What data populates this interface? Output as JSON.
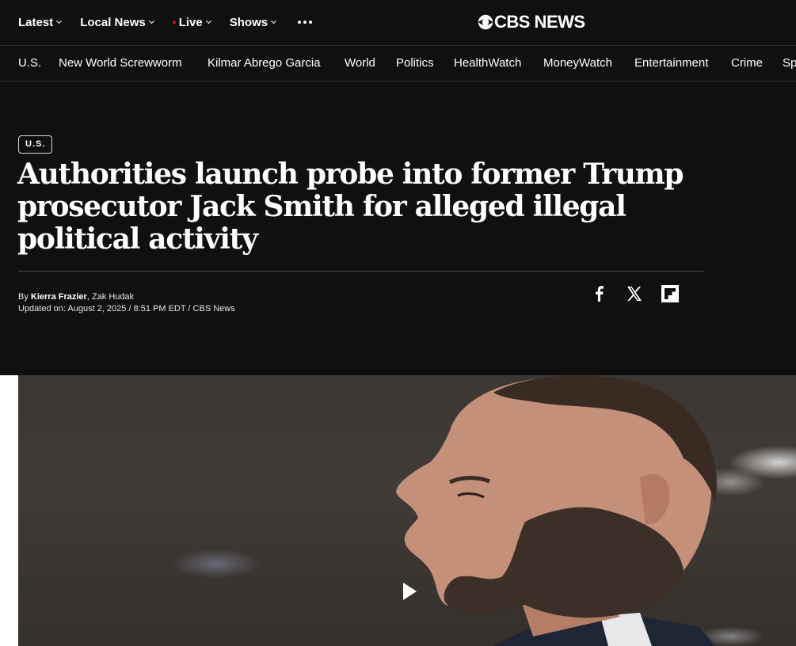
{
  "top_nav": {
    "items": [
      {
        "label": "Latest",
        "has_dropdown": true
      },
      {
        "label": "Local News",
        "has_dropdown": true
      },
      {
        "label": "Live",
        "has_dropdown": true,
        "live_indicator": true
      },
      {
        "label": "Shows",
        "has_dropdown": true
      }
    ],
    "more_icon": "more-horizontal-icon"
  },
  "logo": {
    "text": "CBS NEWS",
    "icon": "cbs-eye-icon"
  },
  "section_nav": {
    "items": [
      "U.S.",
      "New World Screwworm",
      "Kilmar Abrego Garcia",
      "World",
      "Politics",
      "HealthWatch",
      "MoneyWatch",
      "Entertainment",
      "Crime",
      "Sp"
    ]
  },
  "article": {
    "category": "U.S.",
    "headline": "Authorities launch probe into former Trump prosecutor Jack Smith for alleged illegal political activity",
    "byline_prefix": "By",
    "author_1": "Kierra Frazier",
    "author_sep": ",",
    "author_2": "Zak Hudak",
    "updated": "Updated on: August 2, 2025 / 8:51 PM EDT / CBS News"
  },
  "share": [
    {
      "name": "facebook-icon"
    },
    {
      "name": "x-icon"
    },
    {
      "name": "flipboard-icon"
    }
  ],
  "colors": {
    "background": "#101010",
    "text": "#ffffff",
    "live_dot": "#e0001b",
    "divider": "#4a4a4a"
  },
  "media": {
    "play_icon": "play-icon"
  }
}
